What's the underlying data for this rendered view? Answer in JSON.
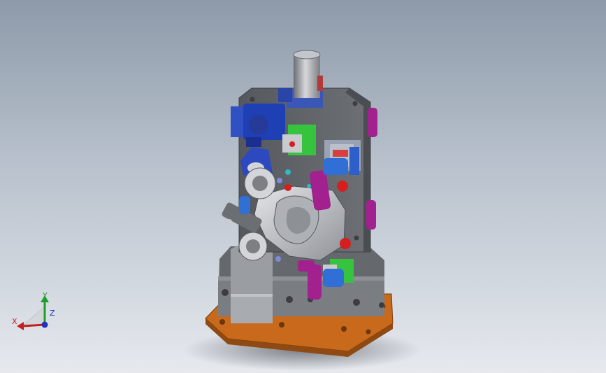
{
  "viewport": {
    "background_top": "#8e9aaa",
    "background_bottom": "#e6e9ee"
  },
  "model": {
    "colors": {
      "base_plate": "#c8691c",
      "frame": "#5e6166",
      "clamp_arms": "#a3208f",
      "cylinders": "#2f6fd6",
      "valve_blocks": "#36c43e",
      "workpiece": "#c9cbcf",
      "pins": "#d61e1e"
    }
  },
  "triad": {
    "x_label": "X",
    "y_label": "Y",
    "z_label": "Z",
    "x_color": "#c41f1f",
    "y_color": "#1f9d2a",
    "z_color": "#2330b8"
  }
}
